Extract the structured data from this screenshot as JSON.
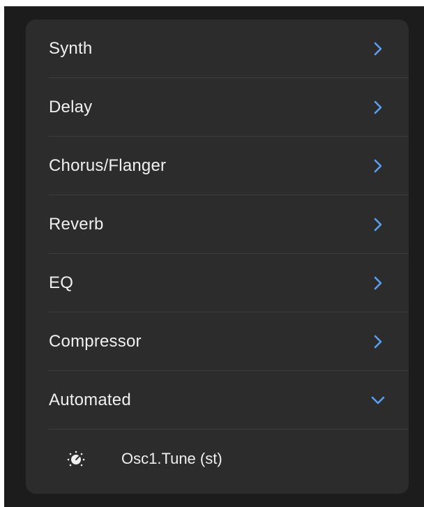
{
  "accent_color": "#5aa0f0",
  "menu": {
    "items": [
      {
        "label": "Synth",
        "icon": "chevron-right-icon"
      },
      {
        "label": "Delay",
        "icon": "chevron-right-icon"
      },
      {
        "label": "Chorus/Flanger",
        "icon": "chevron-right-icon"
      },
      {
        "label": "Reverb",
        "icon": "chevron-right-icon"
      },
      {
        "label": "EQ",
        "icon": "chevron-right-icon"
      },
      {
        "label": "Compressor",
        "icon": "chevron-right-icon"
      },
      {
        "label": "Automated",
        "icon": "chevron-down-icon",
        "expanded": true
      }
    ],
    "automated_params": [
      {
        "label": "Osc1.Tune (st)",
        "icon": "knob-icon"
      }
    ]
  }
}
